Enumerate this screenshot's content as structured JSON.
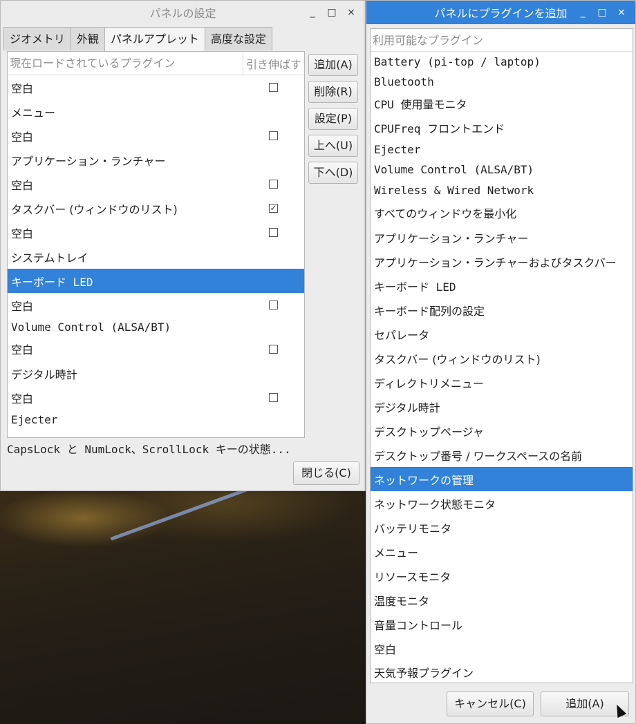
{
  "left_window": {
    "title": "パネルの設定",
    "wm": {
      "minimize": "_",
      "maximize": "□",
      "close": "×"
    },
    "tabs": [
      {
        "label": "ジオメトリ",
        "active": false
      },
      {
        "label": "外観",
        "active": false
      },
      {
        "label": "パネルアプレット",
        "active": true
      },
      {
        "label": "高度な設定",
        "active": false
      }
    ],
    "list": {
      "col_plugin": "現在ロードされているプラグイン",
      "col_stretch": "引き伸ばす",
      "rows": [
        {
          "label": "空白",
          "checkbox": true,
          "checked": false
        },
        {
          "label": "メニュー",
          "checkbox": false,
          "checked": false
        },
        {
          "label": "空白",
          "checkbox": true,
          "checked": false
        },
        {
          "label": "アプリケーション・ランチャー",
          "checkbox": false,
          "checked": false
        },
        {
          "label": "空白",
          "checkbox": true,
          "checked": false
        },
        {
          "label": "タスクバー (ウィンドウのリスト)",
          "checkbox": true,
          "checked": true
        },
        {
          "label": "空白",
          "checkbox": true,
          "checked": false
        },
        {
          "label": "システムトレイ",
          "checkbox": false,
          "checked": false
        },
        {
          "label": "キーボード LED",
          "checkbox": false,
          "checked": false,
          "selected": true
        },
        {
          "label": "空白",
          "checkbox": true,
          "checked": false
        },
        {
          "label": "Volume Control (ALSA/BT)",
          "checkbox": false,
          "checked": false
        },
        {
          "label": "空白",
          "checkbox": true,
          "checked": false
        },
        {
          "label": "デジタル時計",
          "checkbox": false,
          "checked": false
        },
        {
          "label": "空白",
          "checkbox": true,
          "checked": false
        },
        {
          "label": "Ejecter",
          "checkbox": false,
          "checked": false
        }
      ]
    },
    "buttons": {
      "add": "追加(A)",
      "remove": "削除(R)",
      "settings": "設定(P)",
      "up": "上へ(U)",
      "down": "下へ(D)",
      "close": "閉じる(C)"
    },
    "status": "CapsLock と NumLock、ScrollLock キーの状態..."
  },
  "right_window": {
    "title": "パネルにプラグインを追加",
    "wm": {
      "minimize": "_",
      "maximize": "□",
      "close": "×"
    },
    "list_header": "利用可能なプラグイン",
    "items": [
      "Battery (pi-top / laptop)",
      "Bluetooth",
      "CPU 使用量モニタ",
      "CPUFreq フロントエンド",
      "Ejecter",
      "Volume Control (ALSA/BT)",
      "Wireless & Wired Network",
      "すべてのウィンドウを最小化",
      "アプリケーション・ランチャー",
      "アプリケーション・ランチャーおよびタスクバー",
      "キーボード LED",
      "キーボード配列の設定",
      "セパレータ",
      "タスクバー (ウィンドウのリスト)",
      "ディレクトリメニュー",
      "デジタル時計",
      "デスクトップページャ",
      "デスクトップ番号 / ワークスペースの名前",
      "ネットワークの管理",
      "ネットワーク状態モニタ",
      "バッテリモニタ",
      "メニュー",
      "リソースモニタ",
      "温度モニタ",
      "音量コントロール",
      "空白",
      "天気予報プラグイン"
    ],
    "selected_item": "ネットワークの管理",
    "buttons": {
      "cancel": "キャンセル(C)",
      "add": "追加(A)"
    }
  }
}
